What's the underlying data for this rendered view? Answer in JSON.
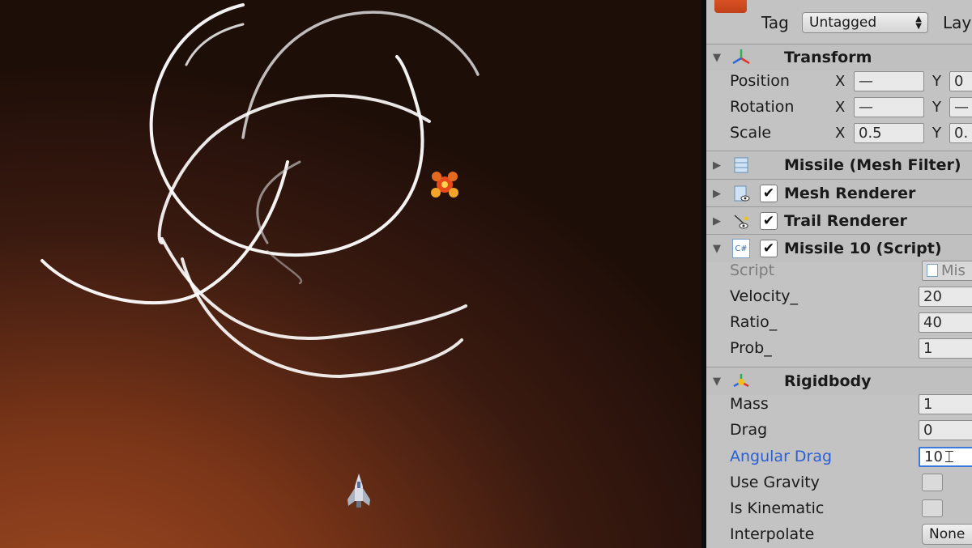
{
  "game_view": {
    "player_ship_icon": "spaceship-icon",
    "enemy_icon": "enemy-ship-icon"
  },
  "inspector": {
    "tag_label": "Tag",
    "tag_value": "Untagged",
    "layer_label": "Lay",
    "transform": {
      "title": "Transform",
      "position": {
        "label": "Position",
        "x_label": "X",
        "x": "—",
        "y_label": "Y",
        "y": "0"
      },
      "rotation": {
        "label": "Rotation",
        "x_label": "X",
        "x": "—",
        "y_label": "Y",
        "y": "—"
      },
      "scale": {
        "label": "Scale",
        "x_label": "X",
        "x": "0.5",
        "y_label": "Y",
        "y": "0."
      }
    },
    "mesh_filter": {
      "title": "Missile (Mesh Filter)"
    },
    "mesh_renderer": {
      "title": "Mesh Renderer",
      "check": "✔"
    },
    "trail_renderer": {
      "title": "Trail Renderer",
      "check": "✔"
    },
    "script": {
      "title": "Missile 10 (Script)",
      "check": "✔",
      "script_label": "Script",
      "script_value": "Mis",
      "script_icon_text": "C#",
      "fields": [
        {
          "label": "Velocity_",
          "value": "20"
        },
        {
          "label": "Ratio_",
          "value": "40"
        },
        {
          "label": "Prob_",
          "value": "1"
        }
      ]
    },
    "rigidbody": {
      "title": "Rigidbody",
      "mass": {
        "label": "Mass",
        "value": "1"
      },
      "drag": {
        "label": "Drag",
        "value": "0"
      },
      "angular_drag": {
        "label": "Angular Drag",
        "value": "10"
      },
      "use_gravity": {
        "label": "Use Gravity"
      },
      "is_kinematic": {
        "label": "Is Kinematic"
      },
      "interpolate": {
        "label": "Interpolate",
        "value": "None"
      }
    }
  }
}
